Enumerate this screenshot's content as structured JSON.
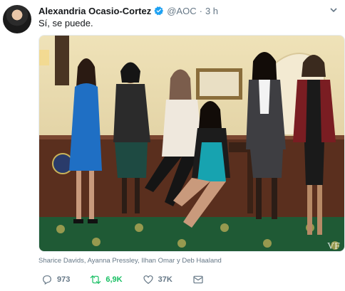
{
  "tweet": {
    "author_name": "Alexandria Ocasio-Cortez",
    "handle": "@AOC",
    "separator": "·",
    "time": "3 h",
    "text": "Sí, se puede.",
    "caption": "Sharice Davids, Ayanna Pressley, Ilhan Omar y Deb Haaland",
    "watermark": "VF"
  },
  "actions": {
    "replies": "973",
    "retweets": "6,9K",
    "likes": "37K"
  },
  "colors": {
    "verified": "#1da1f2",
    "retweet_active": "#17bf63",
    "muted": "#657786"
  }
}
